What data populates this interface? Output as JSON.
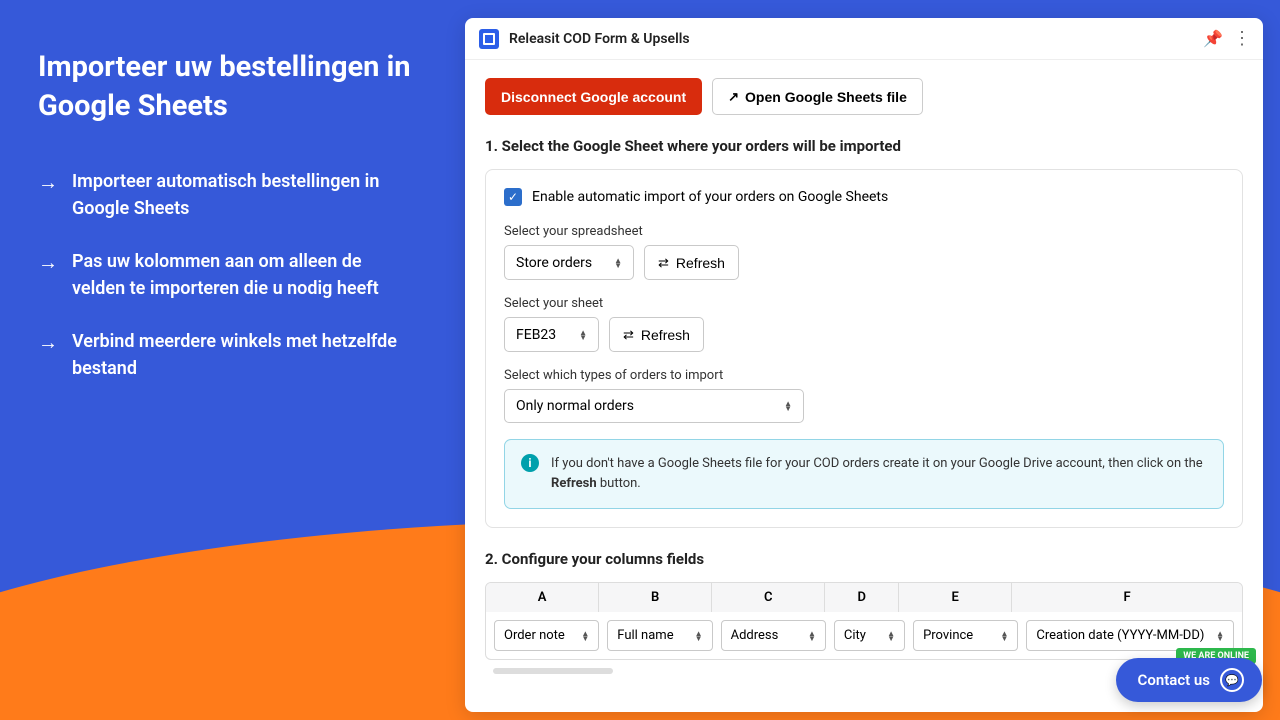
{
  "sidebar": {
    "heading": "Importeer uw bestellingen in Google Sheets",
    "features": [
      "Importeer automatisch bestellingen in Google Sheets",
      "Pas uw kolommen aan om alleen de velden te importeren die u nodig heeft",
      "Verbind meerdere winkels met hetzelfde bestand"
    ]
  },
  "panel": {
    "title": "Releasit COD Form & Upsells",
    "disconnect": "Disconnect Google account",
    "open_sheets": "Open Google Sheets file",
    "section1": "1. Select the Google Sheet where your orders will be imported",
    "enable_label": "Enable automatic import of your orders on Google Sheets",
    "spreadsheet_lbl": "Select your spreadsheet",
    "spreadsheet_val": "Store orders",
    "sheet_lbl": "Select your sheet",
    "sheet_val": "FEB23",
    "types_lbl": "Select which types of orders to import",
    "types_val": "Only normal orders",
    "refresh": "Refresh",
    "info_pre": "If you don't have a Google Sheets file for your COD orders create it on your Google Drive account, then click on the ",
    "info_bold": "Refresh",
    "info_post": " button.",
    "section2": "2. Configure your columns fields",
    "col_letters": [
      "A",
      "B",
      "C",
      "D",
      "E",
      "F"
    ],
    "cols": [
      "Order note",
      "Full name",
      "Address",
      "City",
      "Province",
      "Creation date (YYYY-MM-DD)"
    ]
  },
  "contact": {
    "label": "Contact us",
    "badge": "WE ARE ONLINE"
  }
}
